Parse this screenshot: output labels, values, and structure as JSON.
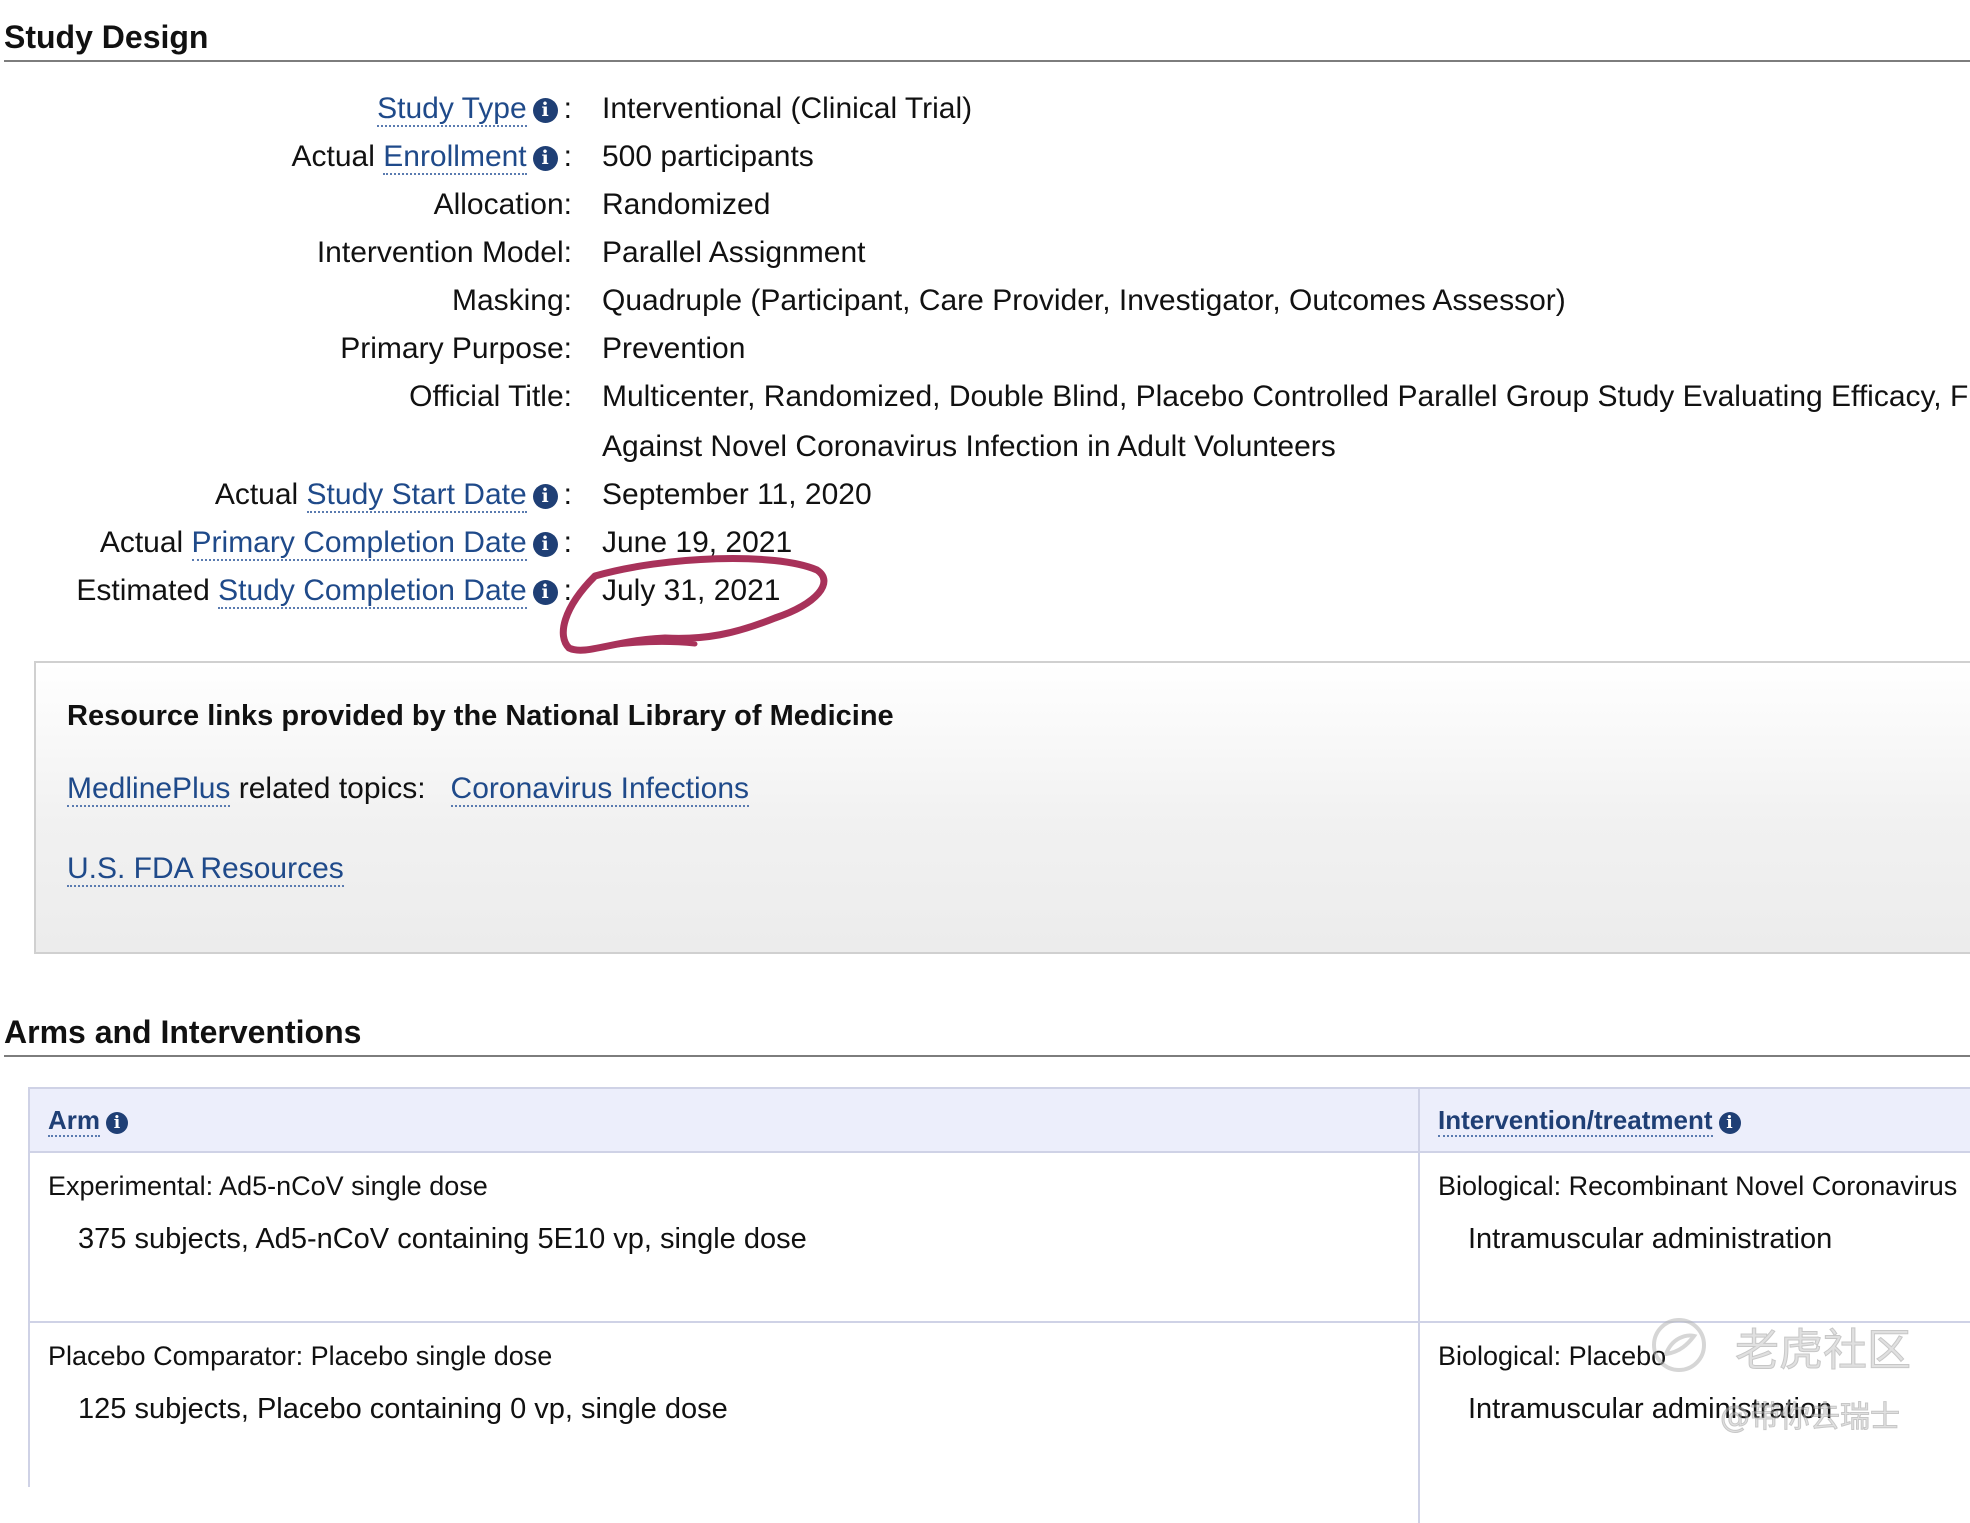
{
  "study_design": {
    "title": "Study Design",
    "rows": [
      {
        "prefix": "",
        "link": "Study Type",
        "info": true,
        "value": "Interventional  (Clinical Trial)"
      },
      {
        "prefix": "Actual ",
        "link": "Enrollment",
        "info": true,
        "value": "500 participants"
      },
      {
        "prefix": "Allocation:",
        "link": "",
        "info": false,
        "value": "Randomized"
      },
      {
        "prefix": "Intervention Model:",
        "link": "",
        "info": false,
        "value": "Parallel Assignment"
      },
      {
        "prefix": "Masking:",
        "link": "",
        "info": false,
        "value": "Quadruple (Participant, Care Provider, Investigator, Outcomes Assessor)"
      },
      {
        "prefix": "Primary Purpose:",
        "link": "",
        "info": false,
        "value": "Prevention"
      },
      {
        "prefix": "Official Title:",
        "link": "",
        "info": false,
        "value": "Multicenter, Randomized, Double Blind, Placebo Controlled Parallel Group Study Evaluating Efficacy, F",
        "value_line2": "Against Novel Coronavirus Infection in Adult Volunteers"
      },
      {
        "prefix": "Actual ",
        "link": "Study Start Date",
        "info": true,
        "value": "September 11, 2020"
      },
      {
        "prefix": "Actual ",
        "link": "Primary Completion Date",
        "info": true,
        "value": "June 19, 2021"
      },
      {
        "prefix": "Estimated ",
        "link": "Study Completion Date",
        "info": true,
        "value": "July 31, 2021"
      }
    ],
    "colon": ":",
    "info_glyph": "i"
  },
  "resource_links": {
    "heading": "Resource links provided by the National Library of Medicine",
    "medline_link": "MedlinePlus",
    "medline_text": " related topics:",
    "medline_topic": "Coronavirus Infections",
    "fda_link": "U.S. FDA Resources"
  },
  "arms": {
    "title": "Arms and Interventions",
    "headers": {
      "arm": "Arm",
      "intervention": "Intervention/treatment"
    },
    "rows": [
      {
        "arm_title": "Experimental: Ad5-nCoV single dose",
        "arm_desc": "375 subjects, Ad5-nCoV containing 5E10 vp, single dose",
        "intervention_title": "Biological: Recombinant Novel Coronavirus",
        "intervention_desc": "Intramuscular administration"
      },
      {
        "arm_title": "Placebo Comparator: Placebo single dose",
        "arm_desc": "125 subjects, Placebo containing 0 vp, single dose",
        "intervention_title": "Biological: Placebo",
        "intervention_desc": "Intramuscular administration"
      }
    ]
  },
  "watermark": {
    "main": "老虎社区",
    "sub": "@带你去瑞士"
  },
  "colors": {
    "link": "#1f4a8a",
    "info_icon_bg": "#1f3f75",
    "annotation_circle": "#a8325a",
    "table_header_bg": "#eceefb"
  }
}
